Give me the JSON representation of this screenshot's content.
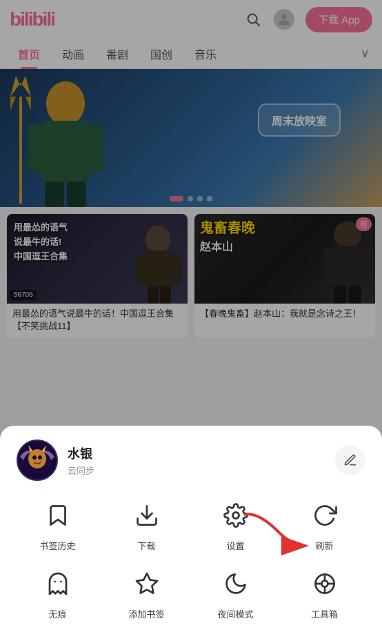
{
  "header": {
    "logo": "bilibili",
    "download_label": "下载 App",
    "search_placeholder": "搜索"
  },
  "nav": {
    "tabs": [
      {
        "id": "home",
        "label": "首页",
        "active": true
      },
      {
        "id": "anime",
        "label": "动画",
        "active": false
      },
      {
        "id": "drama",
        "label": "番剧",
        "active": false
      },
      {
        "id": "guochuang",
        "label": "国创",
        "active": false
      },
      {
        "id": "music",
        "label": "音乐",
        "active": false
      }
    ]
  },
  "banner": {
    "badge_text": "周末放映室",
    "dots": 4,
    "active_dot": 0
  },
  "videos": [
    {
      "title": "用最怂的语气说最牛的话！中国逗王合集【不笑挑战11】",
      "count": "56706",
      "tag": ""
    },
    {
      "title": "【春晚鬼畜】赵本山：我就是念诗之王！",
      "count": "",
      "tag": "可"
    }
  ],
  "bottom_sheet": {
    "user": {
      "name": "水银",
      "sync_label": "云同步"
    },
    "menu_rows": [
      [
        {
          "id": "bookmark",
          "label": "书签历史",
          "icon": "bookmark"
        },
        {
          "id": "download",
          "label": "下载",
          "icon": "download"
        },
        {
          "id": "settings",
          "label": "设置",
          "icon": "settings"
        },
        {
          "id": "refresh",
          "label": "刷新",
          "icon": "refresh"
        }
      ],
      [
        {
          "id": "ghost",
          "label": "无痕",
          "icon": "ghost"
        },
        {
          "id": "add-bookmark",
          "label": "添加书签",
          "icon": "star"
        },
        {
          "id": "night-mode",
          "label": "夜间模式",
          "icon": "moon"
        },
        {
          "id": "toolbox",
          "label": "工具箱",
          "icon": "toolbox"
        }
      ]
    ]
  }
}
